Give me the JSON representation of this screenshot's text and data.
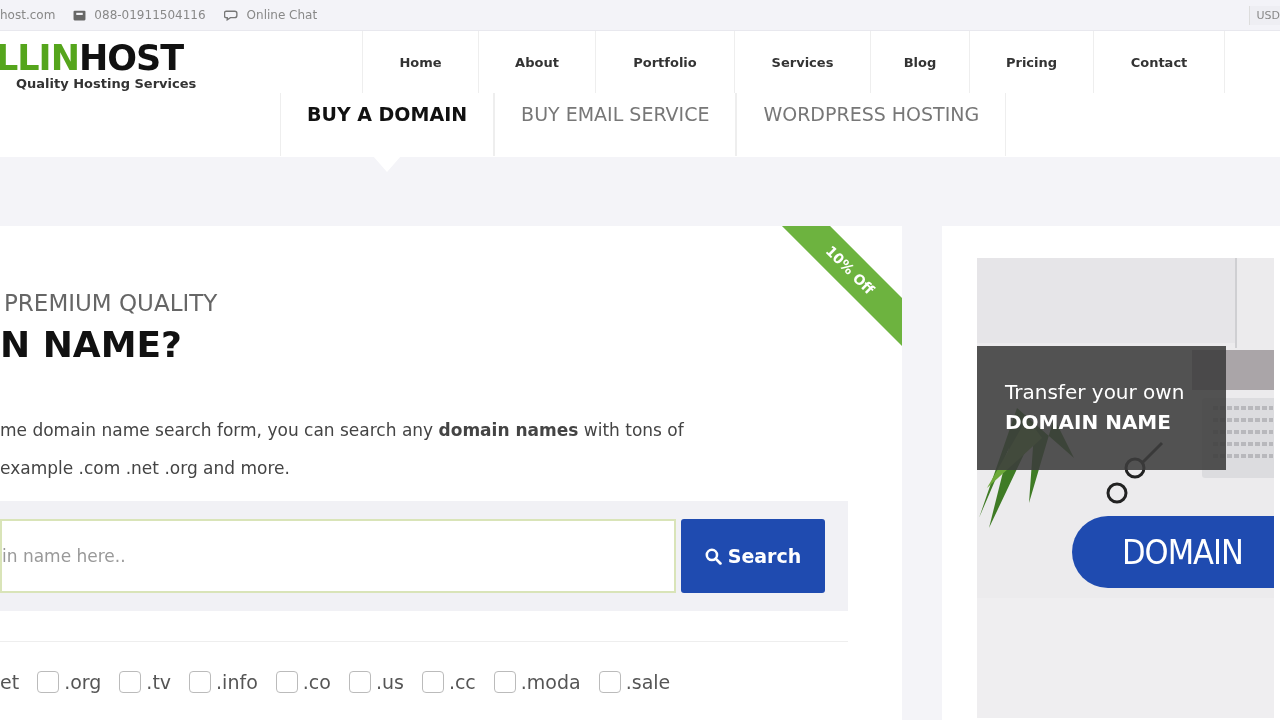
{
  "top_bar": {
    "email": "host.com",
    "phone": "088-01911504116",
    "chat": "Online Chat",
    "currency": "USD"
  },
  "logo": {
    "accent_part": "LLIN",
    "dark_part": "HOST",
    "tagline": "Quality Hosting Services"
  },
  "nav": [
    "Home",
    "About",
    "Portfolio",
    "Services",
    "Blog",
    "Pricing",
    "Contact"
  ],
  "tabs": [
    {
      "label": "BUY A DOMAIN",
      "selected": true
    },
    {
      "label": "BUY EMAIL SERVICE",
      "selected": false
    },
    {
      "label": "WORDPRESS HOSTING",
      "selected": false
    }
  ],
  "search_card": {
    "ribbon": "10% Off",
    "eyebrow": "PREMIUM QUALITY",
    "heading": "N NAME?",
    "description": "me domain name search form, you can search any **domain names** with tons of",
    "description_2": "example .com .net .org and more.",
    "search": {
      "placeholder": "in name here.."
    },
    "search_button": "Search",
    "extensions": [
      {
        "kind": "text",
        "label": "et"
      },
      {
        "kind": "checkbox",
        "label": ".org",
        "checked": false
      },
      {
        "kind": "checkbox",
        "label": ".tv",
        "checked": false
      },
      {
        "kind": "checkbox",
        "label": ".info",
        "checked": false
      },
      {
        "kind": "checkbox",
        "label": ".co",
        "checked": false
      },
      {
        "kind": "checkbox",
        "label": ".us",
        "checked": false
      },
      {
        "kind": "checkbox",
        "label": ".cc",
        "checked": false
      },
      {
        "kind": "checkbox",
        "label": ".moda",
        "checked": false
      },
      {
        "kind": "checkbox",
        "label": ".sale",
        "checked": false
      }
    ]
  },
  "banner": {
    "kind": "picture",
    "caption": "Transfer your own",
    "caption_bold": "DOMAIN NAME",
    "pill": "DOMAIN"
  }
}
